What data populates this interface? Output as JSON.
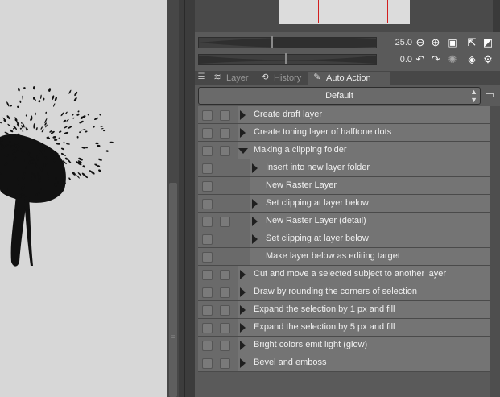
{
  "navigator": {
    "zoom_value": "25.0",
    "rotate_value": "0.0"
  },
  "tabs": [
    {
      "label": "Layer",
      "icon": "layer-icon",
      "active": false
    },
    {
      "label": "History",
      "icon": "history-icon",
      "active": false
    },
    {
      "label": "Auto Action",
      "icon": "auto-action-icon",
      "active": true
    }
  ],
  "set_selector": {
    "value": "Default"
  },
  "actions": [
    {
      "label": "Create draft layer",
      "level": 0,
      "expander": "collapsed",
      "checks": 2
    },
    {
      "label": "Create toning layer of halftone dots",
      "level": 0,
      "expander": "collapsed",
      "checks": 2
    },
    {
      "label": "Making a clipping folder",
      "level": 0,
      "expander": "expanded",
      "checks": 2
    },
    {
      "label": "Insert into new layer folder",
      "level": 1,
      "expander": "collapsed",
      "checks": 1
    },
    {
      "label": "New Raster Layer",
      "level": 1,
      "expander": "none",
      "checks": 1
    },
    {
      "label": "Set clipping at layer below",
      "level": 1,
      "expander": "collapsed",
      "checks": 1
    },
    {
      "label": "New Raster Layer (detail)",
      "level": 1,
      "expander": "collapsed",
      "checks": 2
    },
    {
      "label": "Set clipping at layer below",
      "level": 1,
      "expander": "collapsed",
      "checks": 1
    },
    {
      "label": "Make layer below as editing target",
      "level": 1,
      "expander": "none",
      "checks": 1
    },
    {
      "label": "Cut and move a selected subject to another layer",
      "level": 0,
      "expander": "collapsed",
      "checks": 2
    },
    {
      "label": "Draw by rounding the corners of selection",
      "level": 0,
      "expander": "collapsed",
      "checks": 2
    },
    {
      "label": "Expand the selection by 1 px and fill",
      "level": 0,
      "expander": "collapsed",
      "checks": 2
    },
    {
      "label": "Expand the selection by 5 px and fill",
      "level": 0,
      "expander": "collapsed",
      "checks": 2
    },
    {
      "label": "Bright colors emit light (glow)",
      "level": 0,
      "expander": "collapsed",
      "checks": 2
    },
    {
      "label": "Bevel and emboss",
      "level": 0,
      "expander": "collapsed",
      "checks": 2
    }
  ]
}
